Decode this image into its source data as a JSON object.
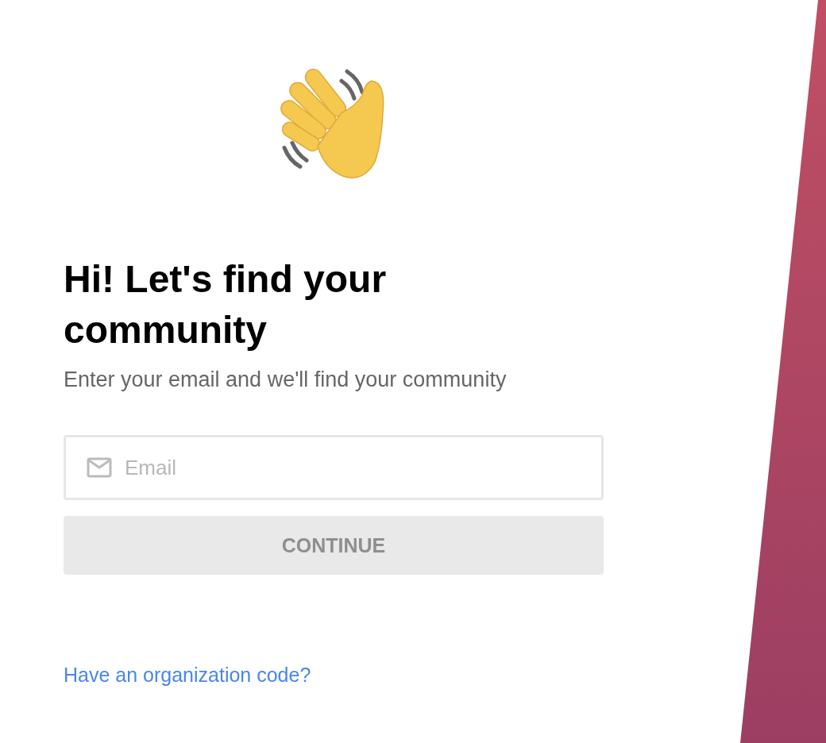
{
  "heading": "Hi! Let's find your community",
  "subtitle": "Enter your email and we'll find your community",
  "email_field": {
    "placeholder": "Email"
  },
  "continue_button": {
    "label": "CONTINUE",
    "disabled": true
  },
  "org_code_link": "Have an organization code?"
}
